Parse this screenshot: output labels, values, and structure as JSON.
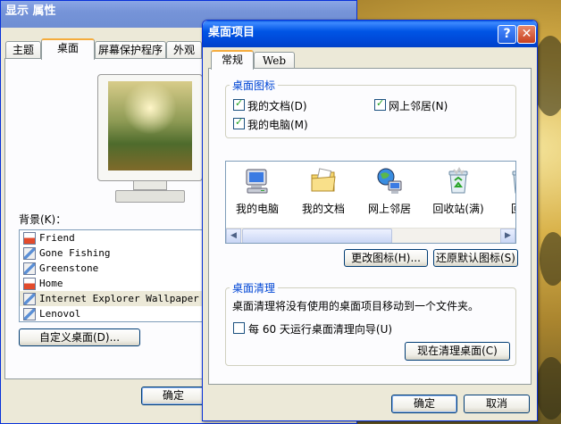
{
  "display_properties": {
    "title": "显示 属性",
    "tabs": [
      "主题",
      "桌面",
      "屏幕保护程序",
      "外观"
    ],
    "active_tab": 1,
    "background_label": "背景(K)：",
    "backgrounds": [
      {
        "name": "Friend",
        "icon": "html-file-icon"
      },
      {
        "name": "Gone Fishing",
        "icon": "image-file-icon"
      },
      {
        "name": "Greenstone",
        "icon": "image-file-icon"
      },
      {
        "name": "Home",
        "icon": "html-file-icon"
      },
      {
        "name": "Internet Explorer Wallpaper",
        "icon": "image-file-icon"
      },
      {
        "name": "Lenovol",
        "icon": "image-file-icon"
      }
    ],
    "selected_background": 4,
    "customize_button": "自定义桌面(D)...",
    "ok_button": "确定"
  },
  "desktop_items": {
    "title": "桌面项目",
    "help_glyph": "?",
    "close_glyph": "✕",
    "tabs": [
      "常规",
      "Web"
    ],
    "desktop_icons_group": "桌面图标",
    "checkboxes": {
      "my_documents": {
        "label": "我的文档(D)",
        "checked": true
      },
      "network_places": {
        "label": "网上邻居(N)",
        "checked": true
      },
      "my_computer": {
        "label": "我的电脑(M)",
        "checked": true
      }
    },
    "icons": [
      {
        "label": "我的电脑",
        "icon": "my-computer-icon"
      },
      {
        "label": "我的文档",
        "icon": "my-documents-icon"
      },
      {
        "label": "网上邻居",
        "icon": "network-places-icon"
      },
      {
        "label": "回收站(满)",
        "icon": "recycle-bin-full-icon"
      },
      {
        "label": "回收",
        "icon": "recycle-bin-empty-icon"
      }
    ],
    "change_icon_button": "更改图标(H)...",
    "restore_default_button": "还原默认图标(S)",
    "cleanup_group": "桌面清理",
    "cleanup_text": "桌面清理将没有使用的桌面项目移动到一个文件夹。",
    "cleanup_checkbox": {
      "label": "每 60 天运行桌面清理向导(U)",
      "checked": false
    },
    "cleanup_now_button": "现在清理桌面(C)",
    "ok_button": "确定",
    "cancel_button": "取消"
  }
}
